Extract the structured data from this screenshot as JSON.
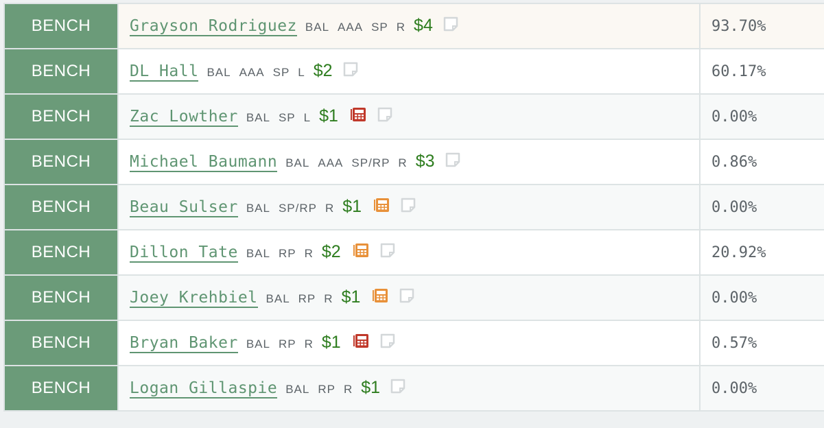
{
  "colors": {
    "slot_bg": "#6b9b79",
    "name": "#5f9572",
    "price": "#2e7d1f",
    "news_red": "#c0392b",
    "news_orange": "#e8913a"
  },
  "rows": [
    {
      "slot": "BENCH",
      "name": "Grayson Rodriguez",
      "team": "BAL",
      "level": "AAA",
      "pos": "SP",
      "hand": "R",
      "price": "$4",
      "news": null,
      "pct": "93.70%"
    },
    {
      "slot": "BENCH",
      "name": "DL Hall",
      "team": "BAL",
      "level": "AAA",
      "pos": "SP",
      "hand": "L",
      "price": "$2",
      "news": null,
      "pct": "60.17%"
    },
    {
      "slot": "BENCH",
      "name": "Zac Lowther",
      "team": "BAL",
      "level": "",
      "pos": "SP",
      "hand": "L",
      "price": "$1",
      "news": "red",
      "pct": "0.00%"
    },
    {
      "slot": "BENCH",
      "name": "Michael Baumann",
      "team": "BAL",
      "level": "AAA",
      "pos": "SP/RP",
      "hand": "R",
      "price": "$3",
      "news": null,
      "pct": "0.86%"
    },
    {
      "slot": "BENCH",
      "name": "Beau Sulser",
      "team": "BAL",
      "level": "",
      "pos": "SP/RP",
      "hand": "R",
      "price": "$1",
      "news": "orange",
      "pct": "0.00%"
    },
    {
      "slot": "BENCH",
      "name": "Dillon Tate",
      "team": "BAL",
      "level": "",
      "pos": "RP",
      "hand": "R",
      "price": "$2",
      "news": "orange",
      "pct": "20.92%"
    },
    {
      "slot": "BENCH",
      "name": "Joey Krehbiel",
      "team": "BAL",
      "level": "",
      "pos": "RP",
      "hand": "R",
      "price": "$1",
      "news": "orange",
      "pct": "0.00%"
    },
    {
      "slot": "BENCH",
      "name": "Bryan Baker",
      "team": "BAL",
      "level": "",
      "pos": "RP",
      "hand": "R",
      "price": "$1",
      "news": "red",
      "pct": "0.57%"
    },
    {
      "slot": "BENCH",
      "name": "Logan Gillaspie",
      "team": "BAL",
      "level": "",
      "pos": "RP",
      "hand": "R",
      "price": "$1",
      "news": null,
      "pct": "0.00%"
    }
  ]
}
